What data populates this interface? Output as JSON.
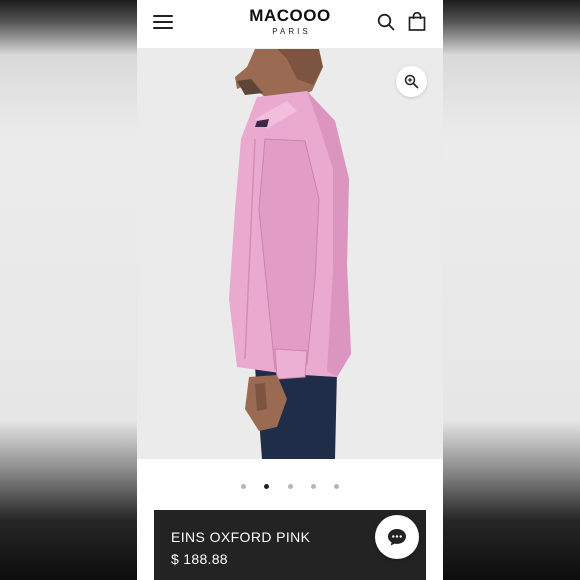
{
  "header": {
    "brand_name": "MACOOO",
    "brand_sub": "PARIS",
    "menu_icon": "hamburger-menu-icon",
    "search_icon": "search-icon",
    "cart_icon": "shopping-bag-icon"
  },
  "gallery": {
    "zoom_icon": "zoom-in-icon",
    "slide_count": 5,
    "active_slide": 2
  },
  "product": {
    "name": "EINS OXFORD PINK",
    "price": "$ 188.88"
  },
  "chat": {
    "icon": "chat-bubble-icon"
  },
  "colors": {
    "shirt": "#eaa9cf",
    "info_bar": "#232323",
    "jeans": "#1f2d49"
  }
}
